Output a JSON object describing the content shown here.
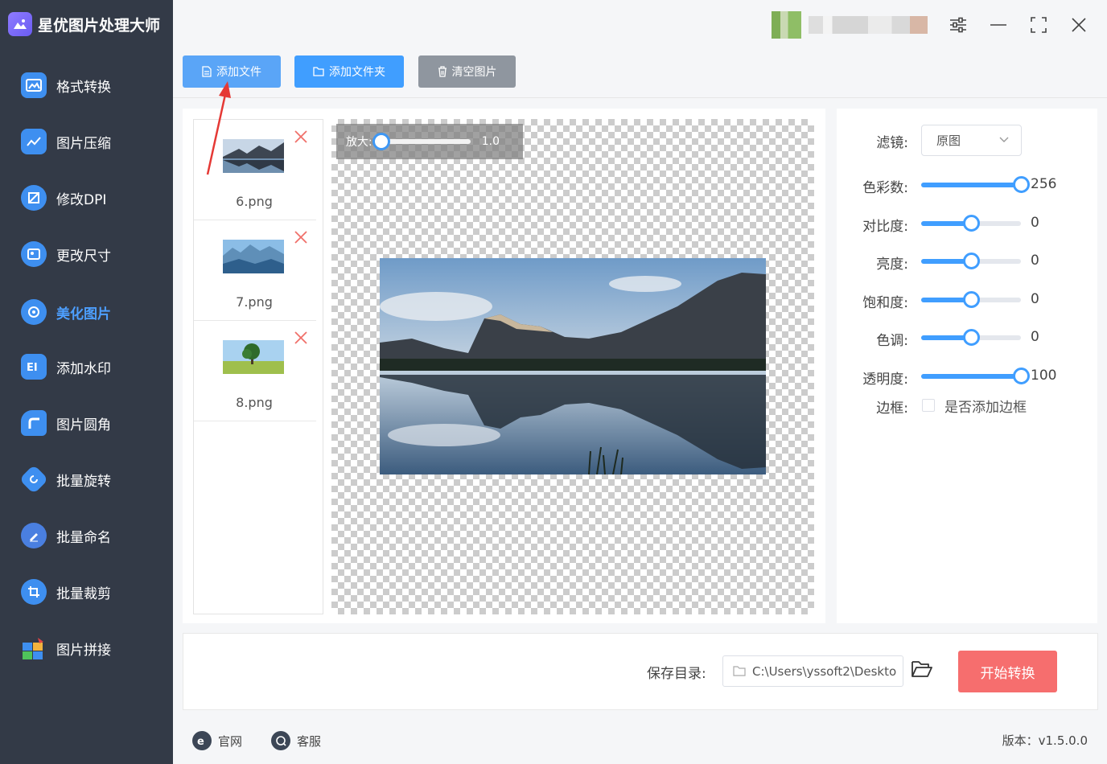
{
  "app": {
    "title": "星优图片处理大师"
  },
  "sidebar": {
    "items": [
      {
        "label": "格式转换",
        "icon": "image-convert-icon",
        "color": "#3e8ff0"
      },
      {
        "label": "图片压缩",
        "icon": "image-compress-icon",
        "color": "#3e8ff0"
      },
      {
        "label": "修改DPI",
        "icon": "dpi-icon",
        "color": "#3e8ff0"
      },
      {
        "label": "更改尺寸",
        "icon": "resize-icon",
        "color": "#3e8ff0"
      },
      {
        "label": "美化图片",
        "icon": "beautify-icon",
        "color": "#3e8ff0",
        "active": true
      },
      {
        "label": "添加水印",
        "icon": "watermark-icon",
        "color": "#3e8ff0"
      },
      {
        "label": "图片圆角",
        "icon": "round-corner-icon",
        "color": "#3e8ff0"
      },
      {
        "label": "批量旋转",
        "icon": "rotate-icon",
        "color": "#3e8ff0"
      },
      {
        "label": "批量命名",
        "icon": "rename-icon",
        "color": "#3e8ff0"
      },
      {
        "label": "批量裁剪",
        "icon": "crop-icon",
        "color": "#3e8ff0"
      },
      {
        "label": "图片拼接",
        "icon": "puzzle-icon",
        "color": "#3e8ff0"
      }
    ]
  },
  "toolbar": {
    "add_file": "添加文件",
    "add_folder": "添加文件夹",
    "clear": "清空图片"
  },
  "files": [
    {
      "name": "6.png"
    },
    {
      "name": "7.png"
    },
    {
      "name": "8.png"
    }
  ],
  "preview": {
    "zoom_label": "放大:",
    "zoom_value": "1.0"
  },
  "settings": {
    "filter_label": "滤镜:",
    "filter_value": "原图",
    "colors_label": "色彩数:",
    "colors_value": "256",
    "contrast_label": "对比度:",
    "contrast_value": "0",
    "brightness_label": "亮度:",
    "brightness_value": "0",
    "saturation_label": "饱和度:",
    "saturation_value": "0",
    "hue_label": "色调:",
    "hue_value": "0",
    "opacity_label": "透明度:",
    "opacity_value": "100",
    "border_label": "边框:",
    "border_checkbox_label": "是否添加边框"
  },
  "bottom": {
    "save_label": "保存目录:",
    "save_path": "C:\\Users\\yssoft2\\Deskto",
    "start_button": "开始转换"
  },
  "footer": {
    "website": "官网",
    "support": "客服",
    "version": "版本：v1.5.0.0"
  },
  "colors": {
    "sidebar_bg": "#333a47",
    "accent": "#409eff",
    "active_nav": "#4d9fff",
    "start_button": "#f66e6e",
    "add_file_button": "#5aa5f7",
    "add_folder_button": "#409eff",
    "clear_button": "#8f969f"
  }
}
